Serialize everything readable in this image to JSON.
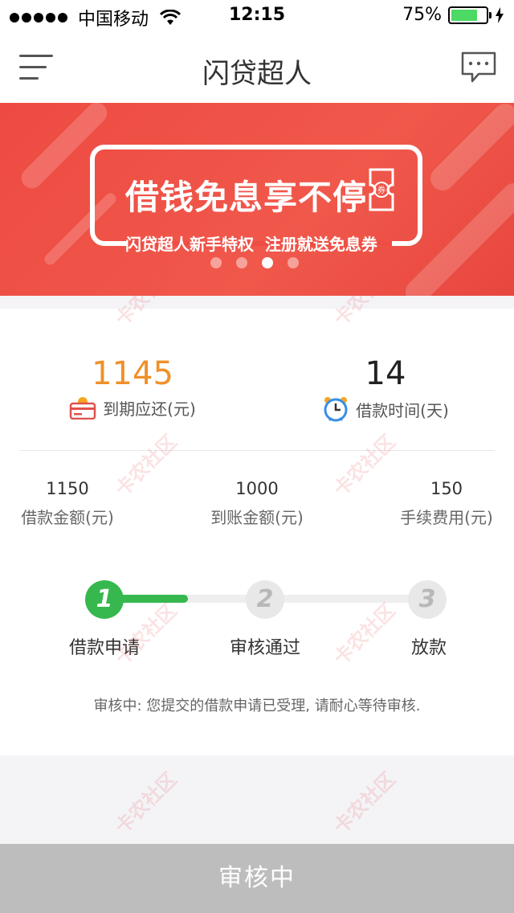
{
  "status_bar": {
    "carrier": "中国移动",
    "time": "12:15",
    "battery": "75%",
    "battery_level": 0.75
  },
  "nav": {
    "title": "闪贷超人"
  },
  "banner": {
    "headline": "借钱免息享不停",
    "subline": "闪贷超人新手特权  注册就送免息券",
    "coupon_glyph": "券",
    "active_page": 2,
    "page_count": 4
  },
  "summary": {
    "due_value": "1145",
    "due_label": "到期应还(元)",
    "days_value": "14",
    "days_label": "借款时间(天)"
  },
  "amounts": {
    "loan_value": "1150",
    "loan_label": "借款金额(元)",
    "received_value": "1000",
    "received_label": "到账金额(元)",
    "fee_value": "150",
    "fee_label": "手续费用(元)"
  },
  "steps": [
    {
      "number": "1",
      "label": "借款申请",
      "state": "active"
    },
    {
      "number": "2",
      "label": "审核通过",
      "state": "pending"
    },
    {
      "number": "3",
      "label": "放款",
      "state": "pending"
    }
  ],
  "status_note": "审核中: 您提交的借款申请已受理, 请耐心等待审核.",
  "bottom_button": {
    "label": "审核中"
  },
  "watermark": "卡农社区",
  "colors": {
    "accent_orange": "#f0902a",
    "brand_red": "#ee4a42",
    "step_green": "#36b84f",
    "disabled_gray": "#bdbdbd"
  }
}
